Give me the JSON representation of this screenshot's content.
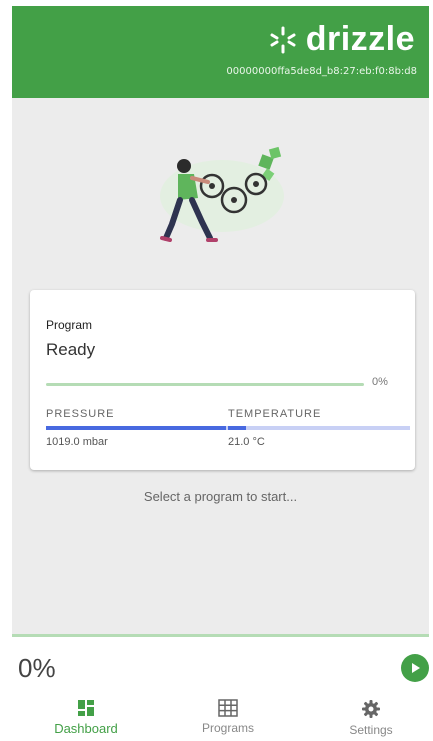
{
  "header": {
    "brand_name": "drizzle",
    "device_id": "00000000ffa5de8d_b8:27:eb:f0:8b:d8",
    "color": "#43a047"
  },
  "program_card": {
    "label": "Program",
    "status": "Ready",
    "progress": 0,
    "progress_label": "0%"
  },
  "sensors": {
    "pressure": {
      "label": "PRESSURE",
      "value": "1019.0 mbar",
      "fill_fraction": 0.99
    },
    "temperature": {
      "label": "TEMPERATURE",
      "value": "21.0 °C",
      "fill_fraction": 0.1
    }
  },
  "hint": "Select a program to start...",
  "bottom": {
    "progress_label": "0%",
    "play_icon": "play-icon"
  },
  "nav": [
    {
      "label": "Dashboard",
      "icon": "dashboard-icon",
      "active": true
    },
    {
      "label": "Programs",
      "icon": "grid-icon",
      "active": false
    },
    {
      "label": "Settings",
      "icon": "gear-icon",
      "active": false
    }
  ],
  "colors": {
    "accent": "#43a047",
    "accent_light": "#b5dcb5",
    "sensor_blue": "#4869e0",
    "sensor_blue_light": "#c8d0f5"
  }
}
